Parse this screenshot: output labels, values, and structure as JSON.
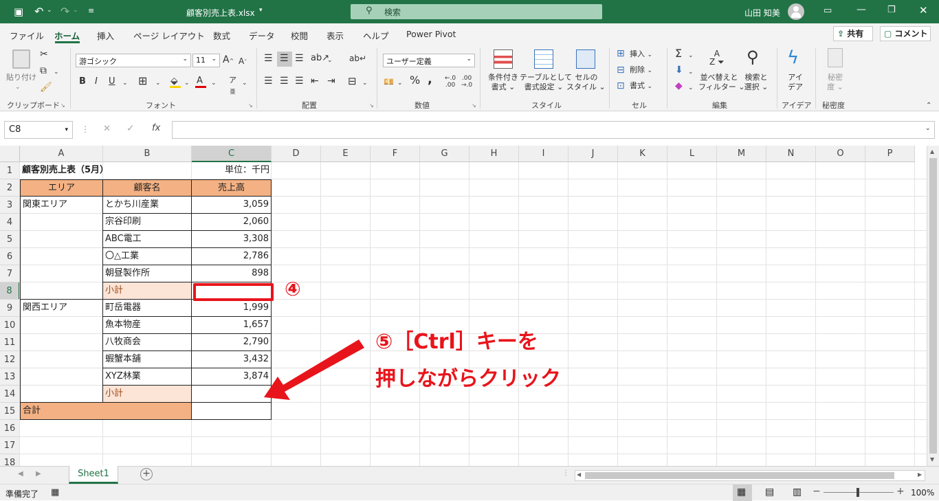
{
  "app": {
    "filename": "顧客別売上表.xlsx",
    "search_placeholder": "検索",
    "user": "山田 知美",
    "share": "共有",
    "comment": "コメント"
  },
  "tabs": [
    "ファイル",
    "ホーム",
    "挿入",
    "ページ レイアウト",
    "数式",
    "データ",
    "校閲",
    "表示",
    "ヘルプ",
    "Power Pivot"
  ],
  "ribbon": {
    "clipboard": {
      "label": "クリップボード",
      "paste": "貼り付け"
    },
    "font": {
      "label": "フォント",
      "name": "游ゴシック",
      "size": "11"
    },
    "alignment": {
      "label": "配置"
    },
    "number": {
      "label": "数値",
      "format": "ユーザー定義"
    },
    "styles": {
      "label": "スタイル",
      "cond1": "条件付き",
      "cond2": "書式",
      "table1": "テーブルとして",
      "table2": "書式設定",
      "cell1": "セルの",
      "cell2": "スタイル"
    },
    "cells": {
      "label": "セル",
      "insert": "挿入",
      "delete": "削除",
      "format": "書式"
    },
    "editing": {
      "label": "編集",
      "sort1": "並べ替えと",
      "sort2": "フィルター",
      "find1": "検索と",
      "find2": "選択"
    },
    "ideas": {
      "label": "アイデア",
      "t1": "アイ",
      "t2": "デア"
    },
    "sensitivity": {
      "label": "秘密度",
      "t1": "秘密",
      "t2": "度"
    }
  },
  "formula_bar": {
    "name_box": "C8",
    "value": ""
  },
  "columns": [
    "A",
    "B",
    "C",
    "D",
    "E",
    "F",
    "G",
    "H",
    "I",
    "J",
    "K",
    "L",
    "M",
    "N",
    "O",
    "P"
  ],
  "rows": [
    "1",
    "2",
    "3",
    "4",
    "5",
    "6",
    "7",
    "8",
    "9",
    "10",
    "11",
    "12",
    "13",
    "14",
    "15",
    "16",
    "17",
    "18"
  ],
  "sheet": {
    "title": "顧客別売上表（5月）",
    "unit": "単位：千円",
    "headers": [
      "エリア",
      "顧客名",
      "売上高"
    ],
    "area_east": "関東エリア",
    "area_west": "関西エリア",
    "east": [
      {
        "name": "とかち川産業",
        "value": "3,059"
      },
      {
        "name": "宗谷印刷",
        "value": "2,060"
      },
      {
        "name": "ABC電工",
        "value": "3,308"
      },
      {
        "name": "〇△工業",
        "value": "2,786"
      },
      {
        "name": "朝昼製作所",
        "value": "898"
      }
    ],
    "west": [
      {
        "name": "町岳電器",
        "value": "1,999"
      },
      {
        "name": "魚本物産",
        "value": "1,657"
      },
      {
        "name": "八牧商会",
        "value": "2,790"
      },
      {
        "name": "蝦蟹本舗",
        "value": "3,432"
      },
      {
        "name": "XYZ林業",
        "value": "3,874"
      }
    ],
    "subtotal": "小計",
    "total": "合計"
  },
  "annotations": {
    "step4": "④",
    "step5_line1": "⑤［Ctrl］キーを",
    "step5_line2": "押しながらクリック"
  },
  "sheet_tab": "Sheet1",
  "status": {
    "ready": "準備完了",
    "zoom": "100%"
  },
  "colors": {
    "header_fill": "#f4b183",
    "subtotal_fill": "#fce4d6",
    "accent": "#217346",
    "annotation": "#e8141b"
  }
}
